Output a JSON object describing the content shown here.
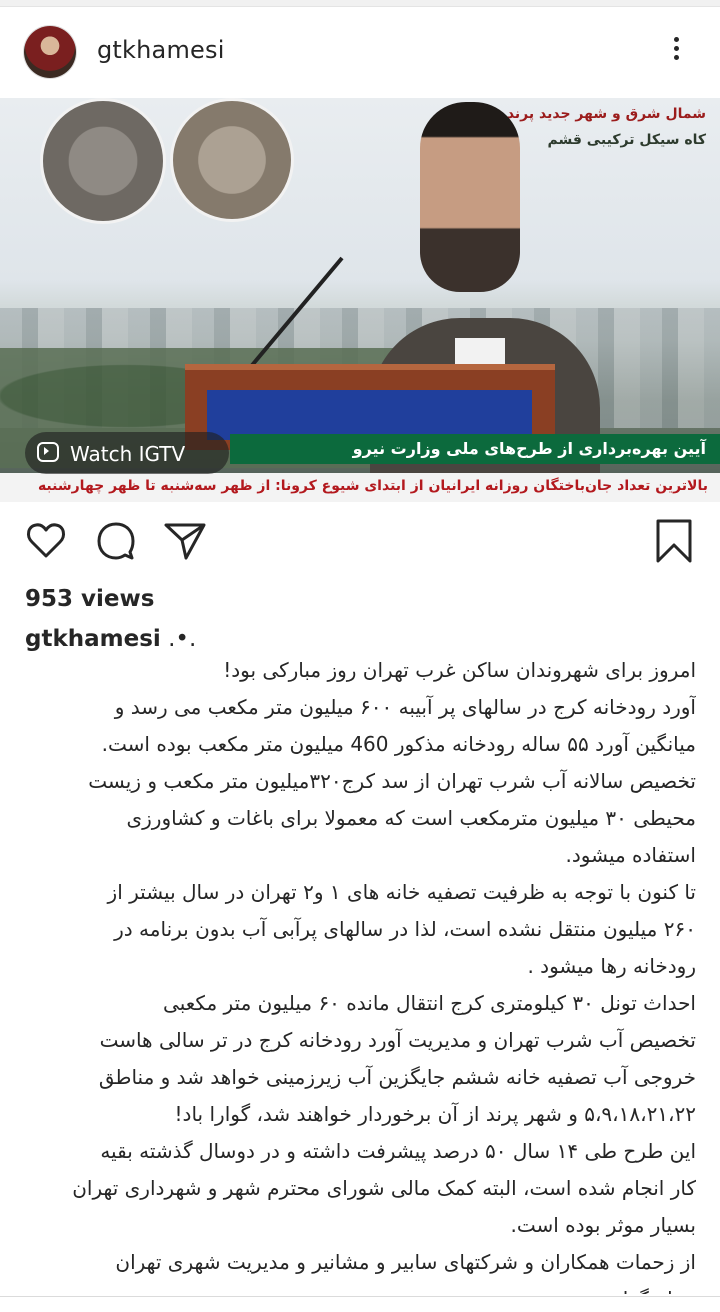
{
  "post": {
    "username": "gtkhamesi",
    "views": "953 views",
    "caption_dots": ".•.",
    "caption_lines": [
      "امروز برای شهروندان ساکن غرب تهران روز مبارکی بود!",
      "آورد رودخانه کرج در سالهای پر آبیبه ۶۰۰ میلیون متر مکعب می رسد و",
      "میانگین آورد ۵۵ ساله رودخانه مذکور 460 میلیون متر مکعب بوده است.",
      "تخصیص سالانه آب شرب تهران از سد کرج۳۲۰میلیون متر مکعب و زیست",
      "محیطی ۳۰ میلیون مترمکعب است که معمولا برای باغات و کشاورزی",
      "استفاده میشود.",
      "تا کنون با توجه به ظرفیت تصفیه خانه های ۱ و۲ تهران در سال بیشتر از",
      "۲۶۰ میلیون منتقل نشده است، لذا در سالهای پرآبی آب بدون برنامه در",
      "رودخانه رها میشود .",
      "احداث تونل ۳۰ کیلومتری کرج انتقال مانده ۶۰ میلیون متر مکعبی",
      "تخصیص آب شرب تهران و مدیریت آورد رودخانه کرج در تر سالی هاست",
      "خروجی آب تصفیه خانه ششم جایگزین آب زیرزمینی خواهد شد و مناطق",
      "۵،۹،۱۸،۲۱،۲۲ و شهر پرند از آن برخوردار خواهند شد، گوارا باد!",
      "این طرح طی ۱۴ سال ۵۰ درصد پیشرفت داشته و در دوسال گذشته بقیه",
      "کار انجام شده است، البته کمک مالی شورای محترم شهر و شهرداری تهران",
      "بسیار موثر بوده است.",
      "از زحمات همکاران و شرکتهای سابیر و مشانیر و مدیریت شهری تهران",
      "سپاسگزارم"
    ]
  },
  "media": {
    "igtv_label": "Watch IGTV",
    "overlay_line1": "شمال شرق و شهر جدید پرند",
    "overlay_line2": "کاه سیکل ترکیبی قشم",
    "ticker_green": "آیین بهره‌برداری از طرح‌های ملی وزارت نیرو",
    "ticker_red": "بالاترین تعداد جان‌باختگان روزانه ایرانیان از ابتدای شیوع کرونا: از ظهر سه‌شنبه تا ظهر چهارشنبه"
  },
  "icons": {
    "like": "heart-icon",
    "comment": "comment-icon",
    "share": "send-icon",
    "save": "bookmark-icon",
    "more": "more-vertical-icon",
    "igtv": "igtv-icon"
  },
  "colors": {
    "text": "#262626",
    "ticker_green": "#0c6a3d",
    "ticker_red_text": "#b3191e"
  }
}
